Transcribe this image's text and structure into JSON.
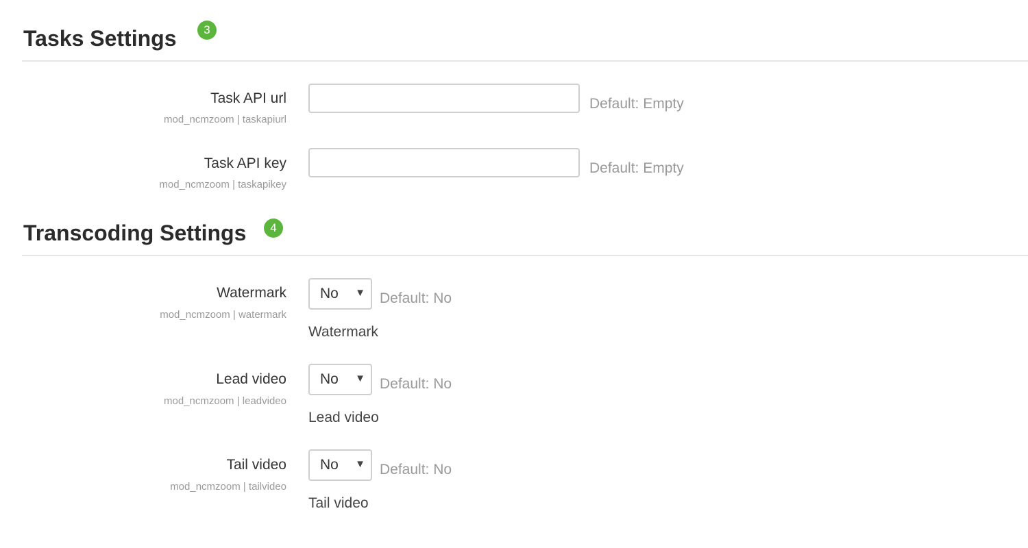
{
  "sections": [
    {
      "title": "Tasks Settings",
      "badge": "3",
      "settings": [
        {
          "label": "Task API url",
          "key": "mod_ncmzoom | taskapiurl",
          "type": "text",
          "value": "",
          "default": "Default: Empty"
        },
        {
          "label": "Task API key",
          "key": "mod_ncmzoom | taskapikey",
          "type": "text",
          "value": "",
          "default": "Default: Empty"
        }
      ]
    },
    {
      "title": "Transcoding Settings",
      "badge": "4",
      "settings": [
        {
          "label": "Watermark",
          "key": "mod_ncmzoom | watermark",
          "type": "select",
          "value": "No",
          "default": "Default: No",
          "description": "Watermark"
        },
        {
          "label": "Lead video",
          "key": "mod_ncmzoom | leadvideo",
          "type": "select",
          "value": "No",
          "default": "Default: No",
          "description": "Lead video"
        },
        {
          "label": "Tail video",
          "key": "mod_ncmzoom | tailvideo",
          "type": "select",
          "value": "No",
          "default": "Default: No",
          "description": "Tail video"
        }
      ]
    }
  ],
  "colors": {
    "badge": "#5cb53c",
    "divider": "#e6e6e6",
    "muted_text": "#999999"
  },
  "icons": {
    "select_arrow": "caret-down-icon"
  }
}
